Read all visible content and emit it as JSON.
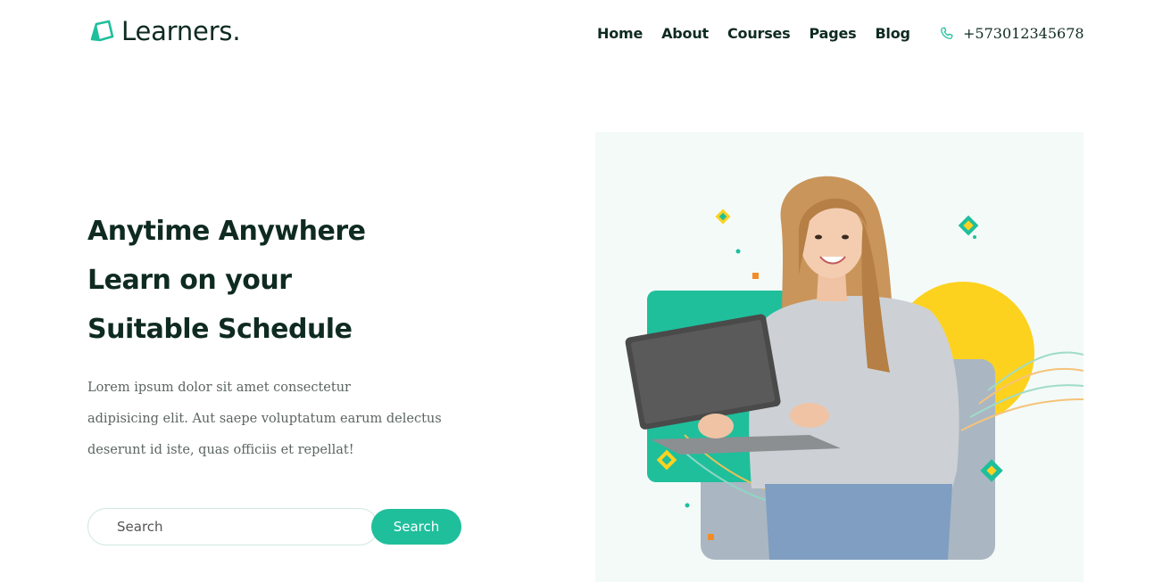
{
  "brand": {
    "name": "Learners.",
    "accent": "#1fbf9c",
    "dark": "#0f2b21"
  },
  "nav": {
    "items": [
      {
        "label": "Home"
      },
      {
        "label": "About"
      },
      {
        "label": "Courses"
      },
      {
        "label": "Pages"
      },
      {
        "label": "Blog"
      }
    ]
  },
  "contact": {
    "icon": "phone-icon",
    "phone": "+573012345678"
  },
  "hero": {
    "title_lines": [
      "Anytime Anywhere",
      "Learn on your",
      "Suitable Schedule"
    ],
    "description_lines": [
      "Lorem ipsum dolor sit amet consectetur",
      "adipisicing elit. Aut saepe voluptatum earum delectus",
      "deserunt id iste, quas officiis et repellat!"
    ],
    "search": {
      "placeholder": "Search",
      "button_label": "Search"
    },
    "colors": {
      "yellow": "#fdd21f",
      "teal": "#1fbf9c",
      "gray": "#a9b6c0"
    }
  }
}
